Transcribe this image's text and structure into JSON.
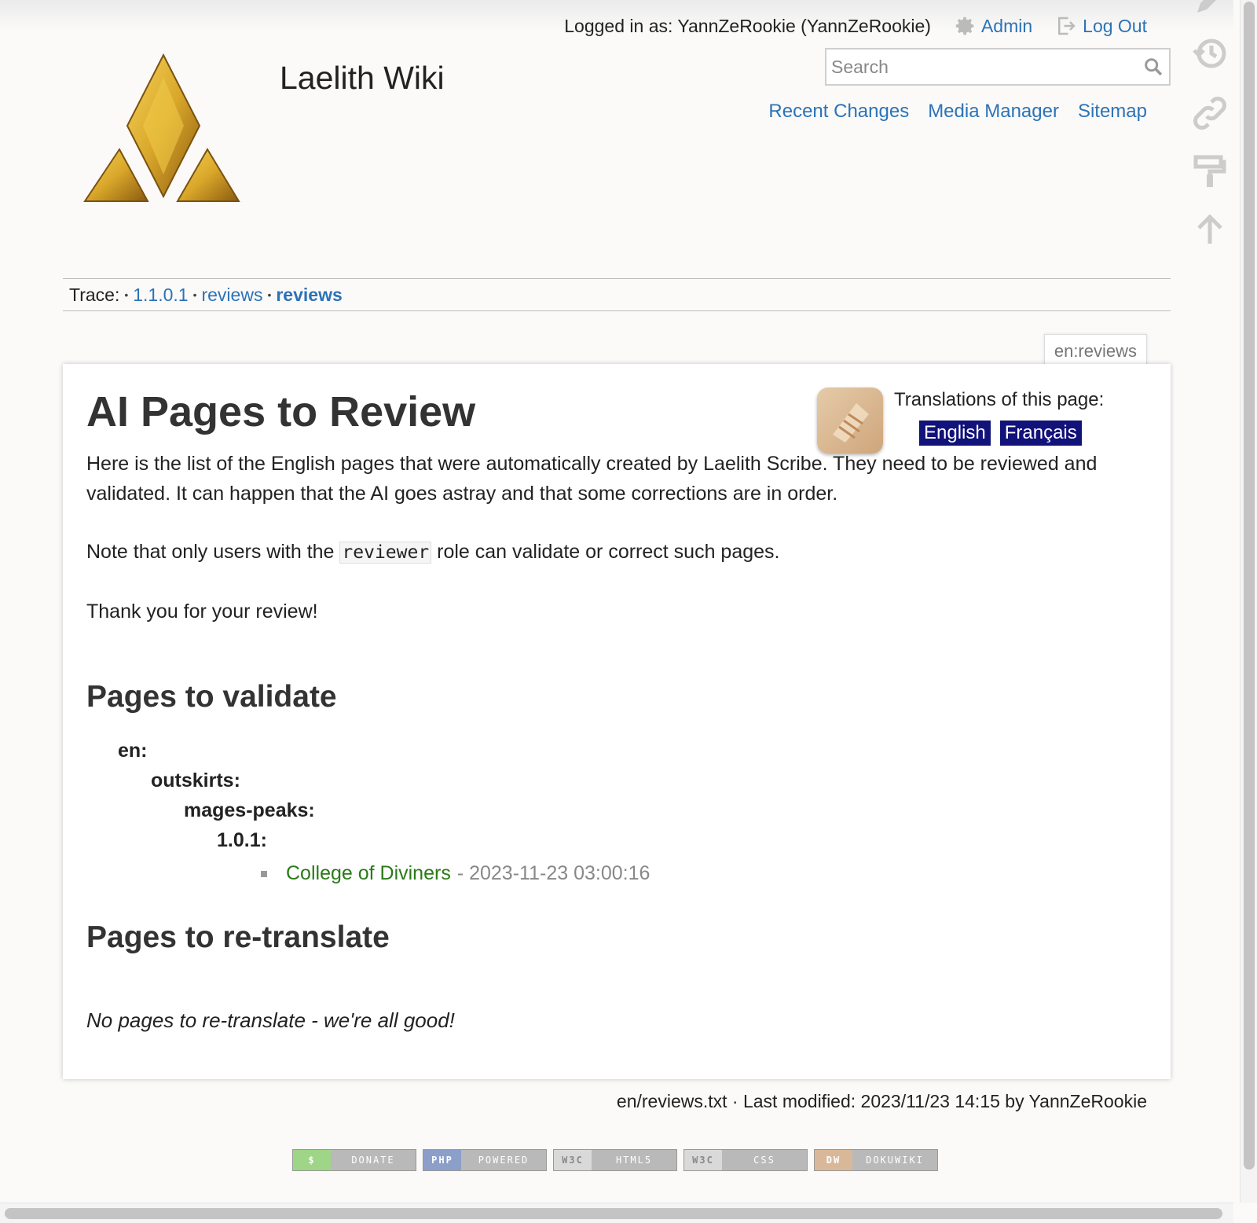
{
  "header": {
    "logged_in_text": "Logged in as: YannZeRookie (YannZeRookie)",
    "admin_label": "Admin",
    "logout_label": "Log Out",
    "search_placeholder": "Search",
    "site_title": "Laelith Wiki",
    "site_tools": [
      "Recent Changes",
      "Media Manager",
      "Sitemap"
    ]
  },
  "breadcrumb": {
    "label": "Trace:",
    "items": [
      "1.1.0.1",
      "reviews",
      "reviews"
    ]
  },
  "page_id": "en:reviews",
  "content": {
    "title": "AI Pages to Review",
    "translations_label": "Translations of this page:",
    "translations": [
      "English",
      "Français"
    ],
    "intro": "Here is the list of the English pages that were automatically created by Laelith Scribe. They need to be reviewed and validated. It can happen that the AI goes astray and that some corrections are in order.",
    "note_before": "Note that only users with the",
    "note_code": "reviewer",
    "note_after": "role can validate or correct such pages.",
    "thanks": "Thank you for your review!",
    "section_validate": "Pages to validate",
    "namespaces": [
      "en:",
      "outskirts:",
      "mages-peaks:",
      "1.0.1:"
    ],
    "entry_link": "College of Diviners",
    "entry_date": "- 2023-11-23 03:00:16",
    "section_retranslate": "Pages to re-translate",
    "no_retranslate": "No pages to re-translate - we're all good!"
  },
  "footer": {
    "last_modified": "en/reviews.txt · Last modified: 2023/11/23 14:15 by YannZeRookie",
    "badges": [
      {
        "left": "$",
        "right": "DONATE",
        "color": "#9fd586"
      },
      {
        "left": "PHP",
        "right": "POWERED",
        "color": "#8c9fc9"
      },
      {
        "left": "W3C",
        "right": "HTML5",
        "color": "#d9d9d9"
      },
      {
        "left": "W3C",
        "right": "CSS",
        "color": "#d9d9d9"
      },
      {
        "left": "DW",
        "right": "DOKUWIKI",
        "color": "#d9b89a"
      }
    ]
  }
}
